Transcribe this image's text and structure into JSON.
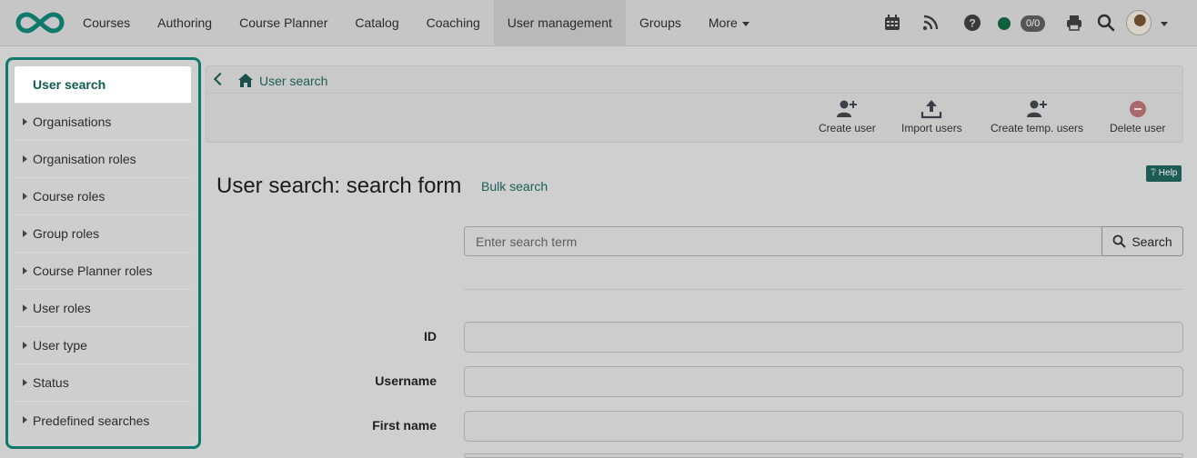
{
  "topnav": {
    "items": [
      "Courses",
      "Authoring",
      "Course Planner",
      "Catalog",
      "Coaching",
      "User management",
      "Groups",
      "More"
    ],
    "active_index": 5,
    "badge": "0/0",
    "status_color": "#115e3a"
  },
  "sidebar": {
    "items": [
      {
        "label": "User search"
      },
      {
        "label": "Organisations"
      },
      {
        "label": "Organisation roles"
      },
      {
        "label": "Course roles"
      },
      {
        "label": "Group roles"
      },
      {
        "label": "Course Planner roles"
      },
      {
        "label": "User roles"
      },
      {
        "label": "User type"
      },
      {
        "label": "Status"
      },
      {
        "label": "Predefined searches"
      }
    ]
  },
  "breadcrumb": {
    "current": "User search"
  },
  "toolbar": {
    "create_user": "Create user",
    "import_users": "Import users",
    "create_temp_users": "Create temp. users",
    "delete_user": "Delete user"
  },
  "main": {
    "title": "User search: search form",
    "bulk_search": "Bulk search",
    "help": "Help"
  },
  "search": {
    "placeholder": "Enter search term",
    "button": "Search"
  },
  "form": {
    "fields": [
      {
        "label": "ID"
      },
      {
        "label": "Username"
      },
      {
        "label": "First name"
      }
    ]
  },
  "colors": {
    "accent": "#0f7a6c",
    "link": "#1c5d55",
    "delete": "#a86a6a"
  }
}
